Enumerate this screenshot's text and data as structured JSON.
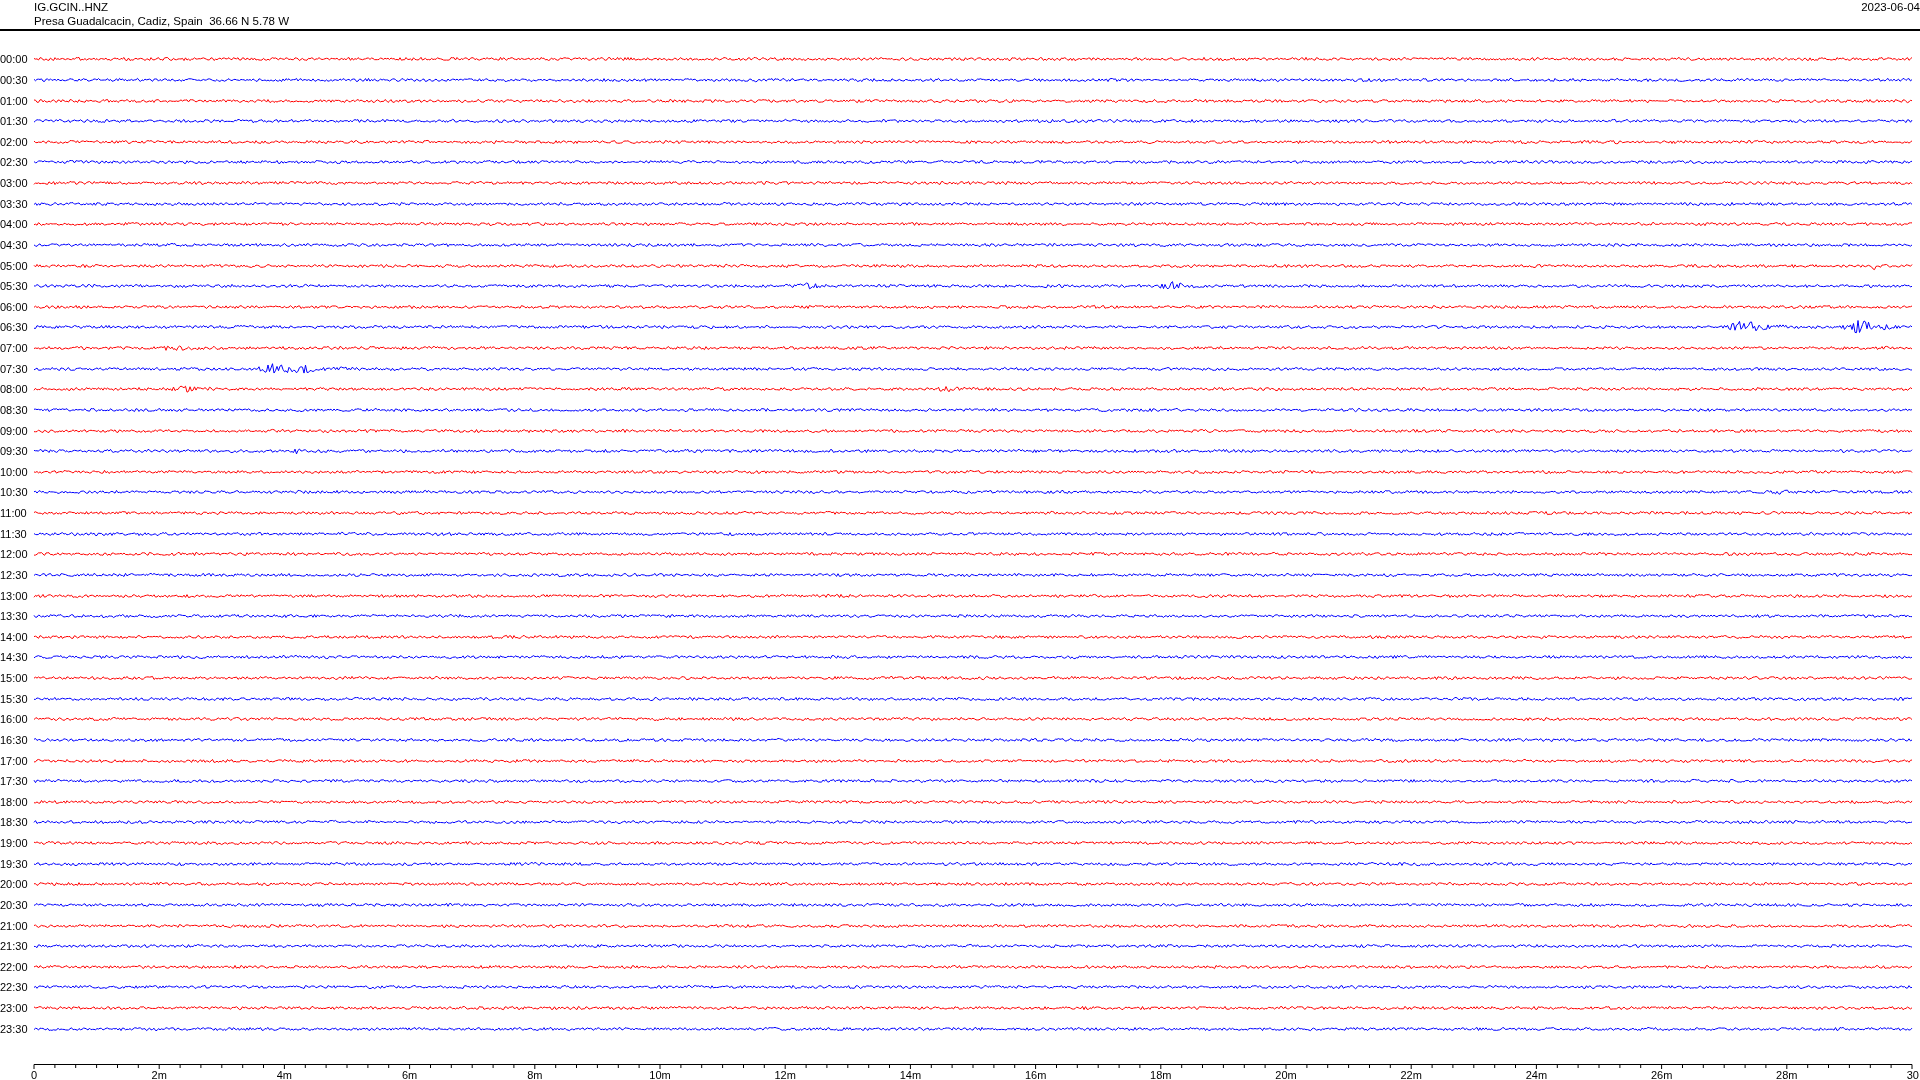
{
  "header": {
    "station": "IG.GCIN..HNZ",
    "location": "Presa Guadalcacin, Cadiz, Spain  36.66 N 5.78 W",
    "date": "2023-06-04"
  },
  "rows": [
    {
      "time": "00:00",
      "color": "#ff0000"
    },
    {
      "time": "00:30",
      "color": "#0000ff"
    },
    {
      "time": "01:00",
      "color": "#ff0000"
    },
    {
      "time": "01:30",
      "color": "#0000ff"
    },
    {
      "time": "02:00",
      "color": "#ff0000"
    },
    {
      "time": "02:30",
      "color": "#0000ff"
    },
    {
      "time": "03:00",
      "color": "#ff0000"
    },
    {
      "time": "03:30",
      "color": "#0000ff"
    },
    {
      "time": "04:00",
      "color": "#ff0000"
    },
    {
      "time": "04:30",
      "color": "#0000ff"
    },
    {
      "time": "05:00",
      "color": "#ff0000"
    },
    {
      "time": "05:30",
      "color": "#0000ff"
    },
    {
      "time": "06:00",
      "color": "#ff0000"
    },
    {
      "time": "06:30",
      "color": "#0000ff"
    },
    {
      "time": "07:00",
      "color": "#ff0000"
    },
    {
      "time": "07:30",
      "color": "#0000ff"
    },
    {
      "time": "08:00",
      "color": "#ff0000"
    },
    {
      "time": "08:30",
      "color": "#0000ff"
    },
    {
      "time": "09:00",
      "color": "#ff0000"
    },
    {
      "time": "09:30",
      "color": "#0000ff"
    },
    {
      "time": "10:00",
      "color": "#ff0000"
    },
    {
      "time": "10:30",
      "color": "#0000ff"
    },
    {
      "time": "11:00",
      "color": "#ff0000"
    },
    {
      "time": "11:30",
      "color": "#0000ff"
    },
    {
      "time": "12:00",
      "color": "#ff0000"
    },
    {
      "time": "12:30",
      "color": "#0000ff"
    },
    {
      "time": "13:00",
      "color": "#ff0000"
    },
    {
      "time": "13:30",
      "color": "#0000ff"
    },
    {
      "time": "14:00",
      "color": "#ff0000"
    },
    {
      "time": "14:30",
      "color": "#0000ff"
    },
    {
      "time": "15:00",
      "color": "#ff0000"
    },
    {
      "time": "15:30",
      "color": "#0000ff"
    },
    {
      "time": "16:00",
      "color": "#ff0000"
    },
    {
      "time": "16:30",
      "color": "#0000ff"
    },
    {
      "time": "17:00",
      "color": "#ff0000"
    },
    {
      "time": "17:30",
      "color": "#0000ff"
    },
    {
      "time": "18:00",
      "color": "#ff0000"
    },
    {
      "time": "18:30",
      "color": "#0000ff"
    },
    {
      "time": "19:00",
      "color": "#ff0000"
    },
    {
      "time": "19:30",
      "color": "#0000ff"
    },
    {
      "time": "20:00",
      "color": "#ff0000"
    },
    {
      "time": "20:30",
      "color": "#0000ff"
    },
    {
      "time": "21:00",
      "color": "#ff0000"
    },
    {
      "time": "21:30",
      "color": "#0000ff"
    },
    {
      "time": "22:00",
      "color": "#ff0000"
    },
    {
      "time": "22:30",
      "color": "#0000ff"
    },
    {
      "time": "23:00",
      "color": "#ff0000"
    },
    {
      "time": "23:30",
      "color": "#0000ff"
    }
  ],
  "x_axis": {
    "labels": [
      "0",
      "2m",
      "4m",
      "6m",
      "8m",
      "10m",
      "12m",
      "14m",
      "16m",
      "18m",
      "20m",
      "22m",
      "24m",
      "26m",
      "28m",
      "30"
    ]
  }
}
